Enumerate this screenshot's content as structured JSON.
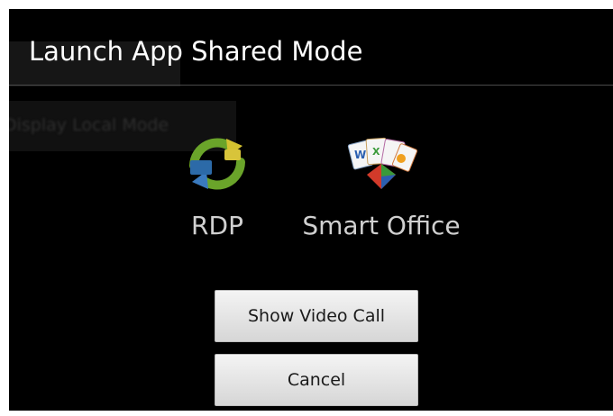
{
  "dialog": {
    "title": "Launch App Shared Mode",
    "background_hint": "Display Local Mode"
  },
  "apps": [
    {
      "label": "RDP",
      "icon": "rdp-refresh-arrows-icon"
    },
    {
      "label": "Smart Office",
      "icon": "smart-office-documents-icon"
    }
  ],
  "buttons": {
    "show_video_call": "Show Video Call",
    "cancel": "Cancel"
  },
  "colors": {
    "dialog_bg": "#000000",
    "title_text": "#ffffff",
    "button_bg": "#e6e6e6"
  }
}
